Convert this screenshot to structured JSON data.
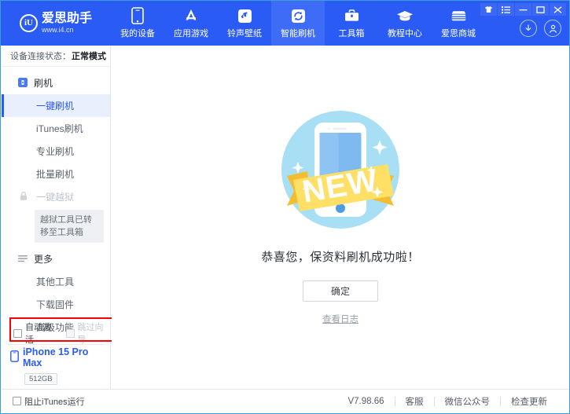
{
  "brand": {
    "logo_glyph": "iU",
    "name": "爱思助手",
    "url": "www.i4.cn"
  },
  "window_controls": [
    {
      "name": "skin-icon",
      "label": "皮肤"
    },
    {
      "name": "menu-icon",
      "label": "菜单"
    },
    {
      "name": "minimize-icon",
      "label": "最小化"
    },
    {
      "name": "maximize-icon",
      "label": "最大化"
    },
    {
      "name": "close-icon",
      "label": "关闭"
    }
  ],
  "account": {
    "download_label": "下载",
    "user_label": "用户"
  },
  "nav": {
    "items": [
      {
        "label": "我的设备",
        "icon": "phone-icon",
        "active": false
      },
      {
        "label": "应用游戏",
        "icon": "appstore-icon",
        "active": false
      },
      {
        "label": "铃声壁纸",
        "icon": "music-icon",
        "active": false
      },
      {
        "label": "智能刷机",
        "icon": "refresh-icon",
        "active": true
      },
      {
        "label": "工具箱",
        "icon": "toolbox-icon",
        "active": false
      },
      {
        "label": "教程中心",
        "icon": "graduation-cap-icon",
        "active": false
      },
      {
        "label": "爱思商城",
        "icon": "store-icon",
        "active": false
      }
    ]
  },
  "sidebar": {
    "connection_label": "设备连接状态：",
    "connection_value": "正常模式",
    "groups": [
      {
        "title": "刷机",
        "icon": "flash-icon",
        "items": [
          {
            "label": "一键刷机",
            "active": true,
            "disabled": false
          },
          {
            "label": "iTunes刷机",
            "active": false,
            "disabled": false
          },
          {
            "label": "专业刷机",
            "active": false,
            "disabled": false
          },
          {
            "label": "批量刷机",
            "active": false,
            "disabled": false
          },
          {
            "label": "一键越狱",
            "active": false,
            "disabled": true
          }
        ],
        "tooltip": "越狱工具已转移至工具箱"
      },
      {
        "title": "更多",
        "icon": "list-icon",
        "items": [
          {
            "label": "其他工具",
            "active": false,
            "disabled": false
          },
          {
            "label": "下载固件",
            "active": false,
            "disabled": false
          },
          {
            "label": "高级功能",
            "active": false,
            "disabled": false
          }
        ]
      }
    ],
    "options": [
      {
        "label": "自动激活",
        "checked": false,
        "disabled": false
      },
      {
        "label": "跳过向导",
        "checked": false,
        "disabled": true
      }
    ],
    "device": {
      "name": "iPhone 15 Pro Max",
      "capacity": "512GB",
      "type": "iPhone"
    }
  },
  "main": {
    "illustration": {
      "ribbon_text": "NEW",
      "alt": "new-device-illustration"
    },
    "success_message": "恭喜您，保资料刷机成功啦！",
    "confirm_label": "确定",
    "log_link_label": "查看日志"
  },
  "statusbar": {
    "block_itunes_label": "阻止iTunes运行",
    "block_itunes_checked": false,
    "version": "V7.98.66",
    "links": [
      "客服",
      "微信公众号",
      "检查更新"
    ]
  },
  "colors": {
    "header_blue": "#2a5bf5",
    "active_tab_blue": "#3f6cf6",
    "accent": "#2a5bf5",
    "highlight_red": "#ff0000",
    "illus_circle": "#a8dff5",
    "illus_ribbon": "#ffe066",
    "illus_ribbon_dark": "#fbc82e"
  }
}
